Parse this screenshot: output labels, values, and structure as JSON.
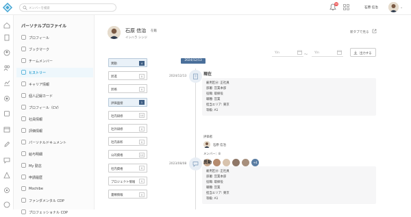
{
  "topbar": {
    "search_placeholder": "メンバーを検索",
    "notification_count": "30",
    "user_name": "石原 信治",
    "chevron": "⌄"
  },
  "menu": {
    "title": "パーソナルプロファイル",
    "items": [
      {
        "label": "プロフィール",
        "icon": "profile-icon",
        "active": false
      },
      {
        "label": "ブックマーク",
        "icon": "bookmark-icon",
        "active": false
      },
      {
        "label": "チームメンバー",
        "icon": "team-icon",
        "active": false
      },
      {
        "label": "ヒストリー",
        "icon": "history-icon",
        "active": true
      },
      {
        "label": "キャリア情報",
        "icon": "career-icon",
        "active": false
      },
      {
        "label": "個人記録カード",
        "icon": "record-card-icon",
        "active": false
      },
      {
        "label": "プロフィール（CV）",
        "icon": "cv-icon",
        "active": false
      },
      {
        "label": "社員情報",
        "icon": "employee-icon",
        "active": false
      },
      {
        "label": "評価情報",
        "icon": "evaluation-icon",
        "active": false
      },
      {
        "label": "パーソナルドキュメント",
        "icon": "document-icon",
        "active": false
      },
      {
        "label": "給与明細",
        "icon": "payslip-icon",
        "active": false
      },
      {
        "label": "My 勤怠",
        "icon": "attendance-icon",
        "active": false
      },
      {
        "label": "申請履歴",
        "icon": "application-icon",
        "active": false
      },
      {
        "label": "Mochibe",
        "icon": "mochibe-icon",
        "active": false
      },
      {
        "label": "ファンダメンタル CDP",
        "icon": "cdp-icon",
        "active": false
      },
      {
        "label": "プロフェッショナル CDP",
        "icon": "cdp-icon",
        "active": false
      }
    ]
  },
  "profile": {
    "name": "石原 信治",
    "status": "在籍",
    "kana": "イシハラ シンジ",
    "open_new_tab": "新タブで見る"
  },
  "toolbar": {
    "date_from": "Y/n",
    "date_to": "Y/n",
    "tilde": "〜",
    "output_button": "出力する"
  },
  "date_tag": "2024/12/13",
  "filters": [
    {
      "label": "異動",
      "count": "4",
      "selected": true
    },
    {
      "label": "昇進",
      "count": "0",
      "selected": false
    },
    {
      "label": "昇格",
      "count": "0",
      "selected": false
    },
    {
      "label": "評価面接",
      "count": "1",
      "selected": true
    },
    {
      "label": "社内研修",
      "count": "10",
      "selected": false
    },
    {
      "label": "社外研修",
      "count": "0",
      "selected": false
    },
    {
      "label": "社内表彰",
      "count": "0",
      "selected": false
    },
    {
      "label": "公的資格",
      "count": "12",
      "selected": false
    },
    {
      "label": "社内資格",
      "count": "0",
      "selected": false
    },
    {
      "label": "プロジェクト情報",
      "count": "0",
      "selected": false
    },
    {
      "label": "書類情報",
      "count": "0",
      "selected": false
    }
  ],
  "timeline": [
    {
      "date": "2024/12/13",
      "title": "現在",
      "rows": [
        "雇用区分: 正社員",
        "部署: 営業本部",
        "役職: 取締役",
        "職種: 営業",
        "担当エリア: 東京",
        "等級: A1"
      ],
      "registrant_label": "評価者",
      "registrant_name": "石原 信治",
      "members_label": "メンバー：8",
      "more_members": "+4"
    },
    {
      "date": "2023/08/08",
      "title": "異動",
      "rows": [
        "雇用区分: 正社員",
        "部署: 営業本部",
        "役職: 取締役",
        "職種: 営業",
        "担当エリア: 東京",
        "等級: A1"
      ]
    }
  ],
  "colors": {
    "accent": "#2a9fd0",
    "selected_badge": "#3f5f85",
    "date_tag": "#4a6f9a"
  }
}
